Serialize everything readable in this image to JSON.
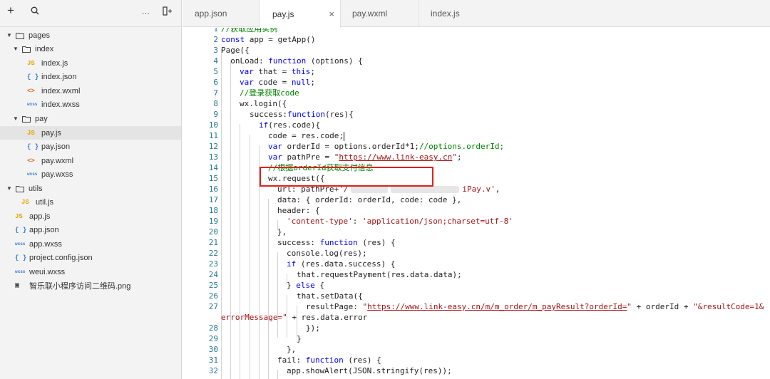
{
  "sidebar": {
    "toolbar": {
      "add": "+",
      "search": "⚲",
      "more": "···",
      "split": "⫞"
    },
    "tree": [
      {
        "label": "pages",
        "type": "folder",
        "arrow": "▼"
      },
      {
        "label": "index",
        "type": "folder",
        "arrow": "▼"
      },
      {
        "label": "index.js",
        "type": "js",
        "icon": "JS"
      },
      {
        "label": "index.json",
        "type": "json",
        "icon": "{ }"
      },
      {
        "label": "index.wxml",
        "type": "wxml",
        "icon": "<>"
      },
      {
        "label": "index.wxss",
        "type": "wxss",
        "icon": "wxss"
      },
      {
        "label": "pay",
        "type": "folder",
        "arrow": "▼"
      },
      {
        "label": "pay.js",
        "type": "js",
        "icon": "JS"
      },
      {
        "label": "pay.json",
        "type": "json",
        "icon": "{ }"
      },
      {
        "label": "pay.wxml",
        "type": "wxml",
        "icon": "<>"
      },
      {
        "label": "pay.wxss",
        "type": "wxss",
        "icon": "wxss"
      },
      {
        "label": "utils",
        "type": "folder",
        "arrow": "▼"
      },
      {
        "label": "util.js",
        "type": "js",
        "icon": "JS"
      },
      {
        "label": "app.js",
        "type": "js",
        "icon": "JS"
      },
      {
        "label": "app.json",
        "type": "json",
        "icon": "{ }"
      },
      {
        "label": "app.wxss",
        "type": "wxss",
        "icon": "wxss"
      },
      {
        "label": "project.config.json",
        "type": "json",
        "icon": "{ }"
      },
      {
        "label": "weui.wxss",
        "type": "wxss",
        "icon": "wxss"
      },
      {
        "label": "智乐联小程序访问二维码.png",
        "type": "png",
        "icon": "▣"
      }
    ]
  },
  "tabs": [
    {
      "label": "app.json"
    },
    {
      "label": "pay.js",
      "close": "×"
    },
    {
      "label": "pay.wxml"
    },
    {
      "label": "index.js"
    }
  ],
  "editor": {
    "line_numbers": [
      "1",
      "2",
      "3",
      "4",
      "5",
      "6",
      "7",
      "8",
      "9",
      "10",
      "11",
      "12",
      "13",
      "14",
      "15",
      "16",
      "17",
      "18",
      "19",
      "20",
      "21",
      "22",
      "23",
      "24",
      "25",
      "26",
      "27",
      "28",
      "29",
      "30",
      "31",
      "32"
    ],
    "code": {
      "l1": "//获取应用实例",
      "l2a": "const",
      "l2b": " app = getApp()",
      "l3": "Page({",
      "l4a": "  onLoad: ",
      "l4b": "function",
      "l4c": " (options) {",
      "l5a": "var",
      "l5b": " that = ",
      "l5c": "this",
      "l5d": ";",
      "l6a": "var",
      "l6b": " code = ",
      "l6c": "null",
      "l6d": ";",
      "l7": "//登录获取code",
      "l8": "wx.login({",
      "l9a": "success:",
      "l9b": "function",
      "l9c": "(res){",
      "l10a": "if",
      "l10b": "(res.code){",
      "l11": "code = res.code;",
      "l12a": "var",
      "l12b": " orderId = options.orderId*1;",
      "l12c": "//options.orderId;",
      "l13a": "var",
      "l13b": " pathPre = ",
      "l13c": "\"",
      "l13d": "https://www.link-easy.cn",
      "l13e": "\"",
      "l13f": ";",
      "l14": "//根据orderId获取支付信息",
      "l15": "wx.request({",
      "l16a": "url: pathPre+",
      "l16b": "'/",
      "l16c": "iPay.v'",
      "l16d": ",",
      "l17": "data: { orderId: orderId, code: code },",
      "l18": "header: {",
      "l19a": "'content-type'",
      "l19b": ": ",
      "l19c": "'application/json;charset=utf-8'",
      "l20": "},",
      "l21a": "success: ",
      "l21b": "function",
      "l21c": " (res) {",
      "l22": "console.log(res);",
      "l23a": "if",
      "l23b": " (res.data.success) {",
      "l24": "that.requestPayment(res.data.data);",
      "l25a": "} ",
      "l25b": "else",
      "l25c": " {",
      "l26": "that.setData({",
      "l27a": "resultPage: ",
      "l27b": "\"",
      "l27c": "https://www.link-easy.cn/m/m_order/m_payResult?orderId=",
      "l27d": "\"",
      "l27e": " + orderId + ",
      "l27f": "\"&resultCode=1&",
      "l27g": "errorMessage=\"",
      "l27h": " + res.data.error",
      "l28": "});",
      "l29": "}",
      "l30": "},",
      "l31a": "fail: ",
      "l31b": "function",
      "l31c": " (res) {",
      "l32": "app.showAlert(JSON.stringify(res));"
    }
  }
}
